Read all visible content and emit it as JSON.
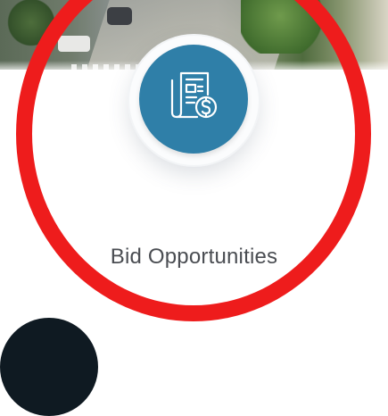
{
  "card": {
    "label": "Bid Opportunities",
    "icon": "bid-document-dollar-icon",
    "icon_color": "#2f7fa8"
  },
  "annotation": {
    "ring_color": "#ee1c1c"
  }
}
